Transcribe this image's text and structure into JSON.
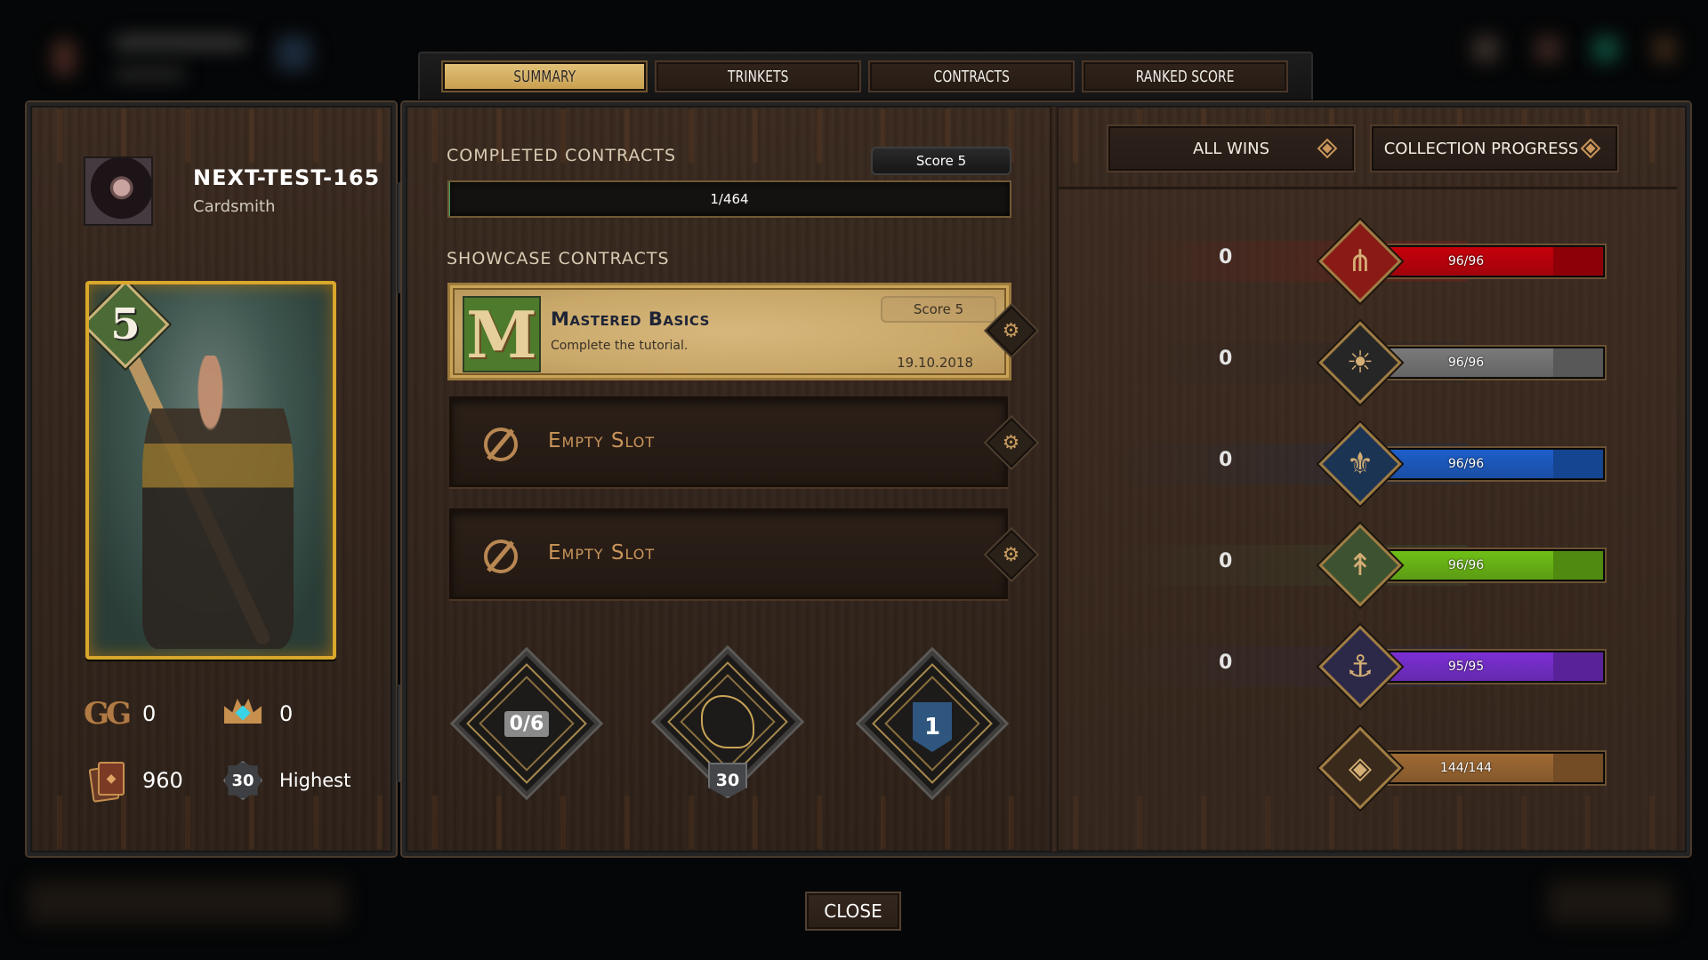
{
  "tabs": [
    {
      "label": "SUMMARY",
      "active": true
    },
    {
      "label": "TRINKETS",
      "active": false
    },
    {
      "label": "CONTRACTS",
      "active": false
    },
    {
      "label": "RANKED SCORE",
      "active": false
    }
  ],
  "profile": {
    "name": "NEXT-TEST-165",
    "title": "Cardsmith",
    "card_power": "5",
    "stats": {
      "gg": "0",
      "crowns": "0",
      "cards": "960",
      "rank": "30",
      "rank_label": "Highest"
    }
  },
  "contracts": {
    "completed_title": "Completed Contracts",
    "completed_score": "Score 5",
    "completed_progress": "1/464",
    "completed_fraction": 0.0022,
    "showcase_title": "Showcase Contracts",
    "showcase": [
      {
        "title": "Mastered Basics",
        "description": "Complete the tutorial.",
        "score": "Score 5",
        "date": "19.10.2018",
        "icon_letter": "M"
      }
    ],
    "empty_slots": [
      "Empty Slot",
      "Empty Slot"
    ]
  },
  "badges": {
    "crowns_progress": "0/6",
    "level": "30",
    "banner": "1"
  },
  "factions": {
    "sort_wins_label": "ALL WINS",
    "sort_collection_label": "COLLECTION PROGRESS",
    "rows": [
      {
        "name": "monsters",
        "icon": "claw-icon",
        "glyph": "⋔",
        "wins": "0",
        "progress": "96/96",
        "fraction": 1.0,
        "color": "#c5000b",
        "bg": "#8a1a16"
      },
      {
        "name": "nilfgaard",
        "icon": "sun-icon",
        "glyph": "☀",
        "wins": "0",
        "progress": "96/96",
        "fraction": 1.0,
        "color": "#7a7a7a",
        "bg": "#262626"
      },
      {
        "name": "northern-realms",
        "icon": "fleur-de-lis-icon",
        "glyph": "⚜",
        "wins": "0",
        "progress": "96/96",
        "fraction": 1.0,
        "color": "#1d5ec9",
        "bg": "#1c3453"
      },
      {
        "name": "scoiatael",
        "icon": "arrows-icon",
        "glyph": "↟",
        "wins": "0",
        "progress": "96/96",
        "fraction": 1.0,
        "color": "#6fbf16",
        "bg": "#3c5230"
      },
      {
        "name": "skellige",
        "icon": "ship-icon",
        "glyph": "⚓",
        "wins": "0",
        "progress": "95/95",
        "fraction": 1.0,
        "color": "#7b2fd4",
        "bg": "#2c2848"
      },
      {
        "name": "neutral",
        "icon": "neutral-diamond-icon",
        "glyph": "◈",
        "wins": "",
        "progress": "144/144",
        "fraction": 1.0,
        "color": "#a06a33",
        "bg": "#3a2a1c"
      }
    ]
  },
  "close_label": "CLOSE"
}
